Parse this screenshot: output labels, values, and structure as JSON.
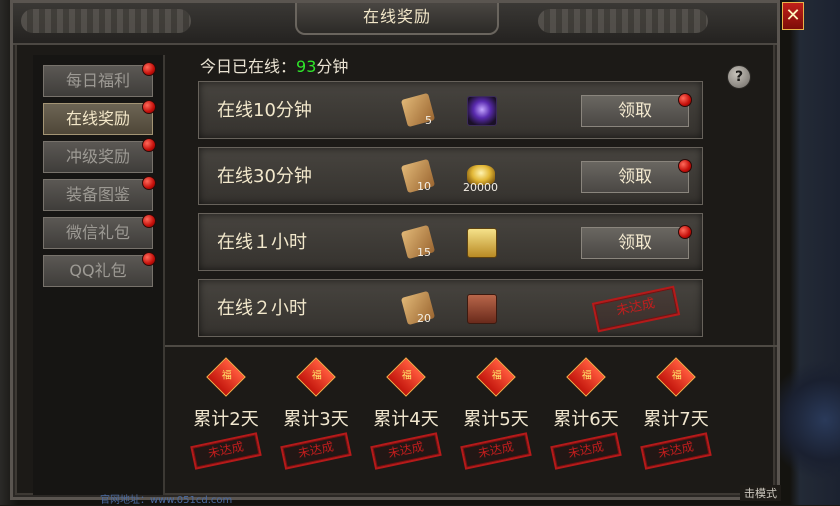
{
  "window": {
    "title": "在线奖励",
    "close_label": "✕"
  },
  "sidebar": {
    "items": [
      {
        "label": "每日福利",
        "active": false,
        "has_dot": true
      },
      {
        "label": "在线奖励",
        "active": true,
        "has_dot": true
      },
      {
        "label": "冲级奖励",
        "active": false,
        "has_dot": true
      },
      {
        "label": "装备图鉴",
        "active": false,
        "has_dot": true
      },
      {
        "label": "微信礼包",
        "active": false,
        "has_dot": true
      },
      {
        "label": "QQ礼包",
        "active": false,
        "has_dot": true
      }
    ]
  },
  "online": {
    "prefix": "今日已在线：",
    "minutes": "93",
    "suffix": "分钟"
  },
  "help_label": "?",
  "rewards": [
    {
      "label": "在线10分钟",
      "item1_count": "5",
      "item2": "purple-crystal",
      "item2_count": "",
      "action": "领取",
      "status": "claimable"
    },
    {
      "label": "在线30分钟",
      "item1_count": "10",
      "item2": "gold-ingot",
      "item2_count": "20000",
      "action": "领取",
      "status": "claimable"
    },
    {
      "label": "在线１小时",
      "item1_count": "15",
      "item2": "gold-chest",
      "item2_count": "",
      "action": "领取",
      "status": "claimable"
    },
    {
      "label": "在线２小时",
      "item1_count": "20",
      "item2": "wood-chest",
      "item2_count": "",
      "action": "未达成",
      "status": "not-reached"
    }
  ],
  "cumulative": [
    {
      "label": "累计2天",
      "status": "未达成"
    },
    {
      "label": "累计3天",
      "status": "未达成"
    },
    {
      "label": "累计4天",
      "status": "未达成"
    },
    {
      "label": "累计5天",
      "status": "未达成"
    },
    {
      "label": "累计6天",
      "status": "未达成"
    },
    {
      "label": "累计7天",
      "status": "未达成"
    }
  ],
  "footer": {
    "left_text": "官网地址：www.051cd.com",
    "right_text": "击模式"
  },
  "colors": {
    "accent": "#2fe52a",
    "stamp": "#c21d1d",
    "dot": "#d9140e"
  }
}
